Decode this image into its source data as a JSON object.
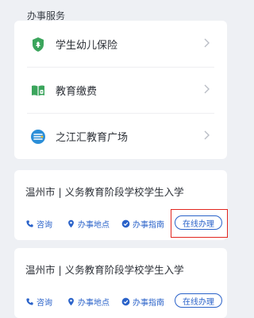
{
  "services_section": {
    "title": "办事服务",
    "items": [
      {
        "label": "学生幼儿保险",
        "icon": "insurance-shield-icon",
        "color": "#3ba55c"
      },
      {
        "label": "教育缴费",
        "icon": "book-payment-icon",
        "color": "#3ba55c"
      },
      {
        "label": "之江汇教育广场",
        "icon": "education-square-icon",
        "color": "#2b8ed8"
      }
    ]
  },
  "process_cards": [
    {
      "title": "温州市 | 义务教育阶段学校学生入学",
      "actions": {
        "consult": "咨询",
        "location": "办事地点",
        "guide": "办事指南"
      },
      "online_button": "在线办理"
    },
    {
      "title": "温州市 | 义务教育阶段学校学生入学",
      "actions": {
        "consult": "咨询",
        "location": "办事地点",
        "guide": "办事指南"
      },
      "online_button": "在线办理"
    }
  ],
  "colors": {
    "accent": "#2a62c9",
    "highlight": "#e2261f",
    "background": "#eef0f4"
  }
}
